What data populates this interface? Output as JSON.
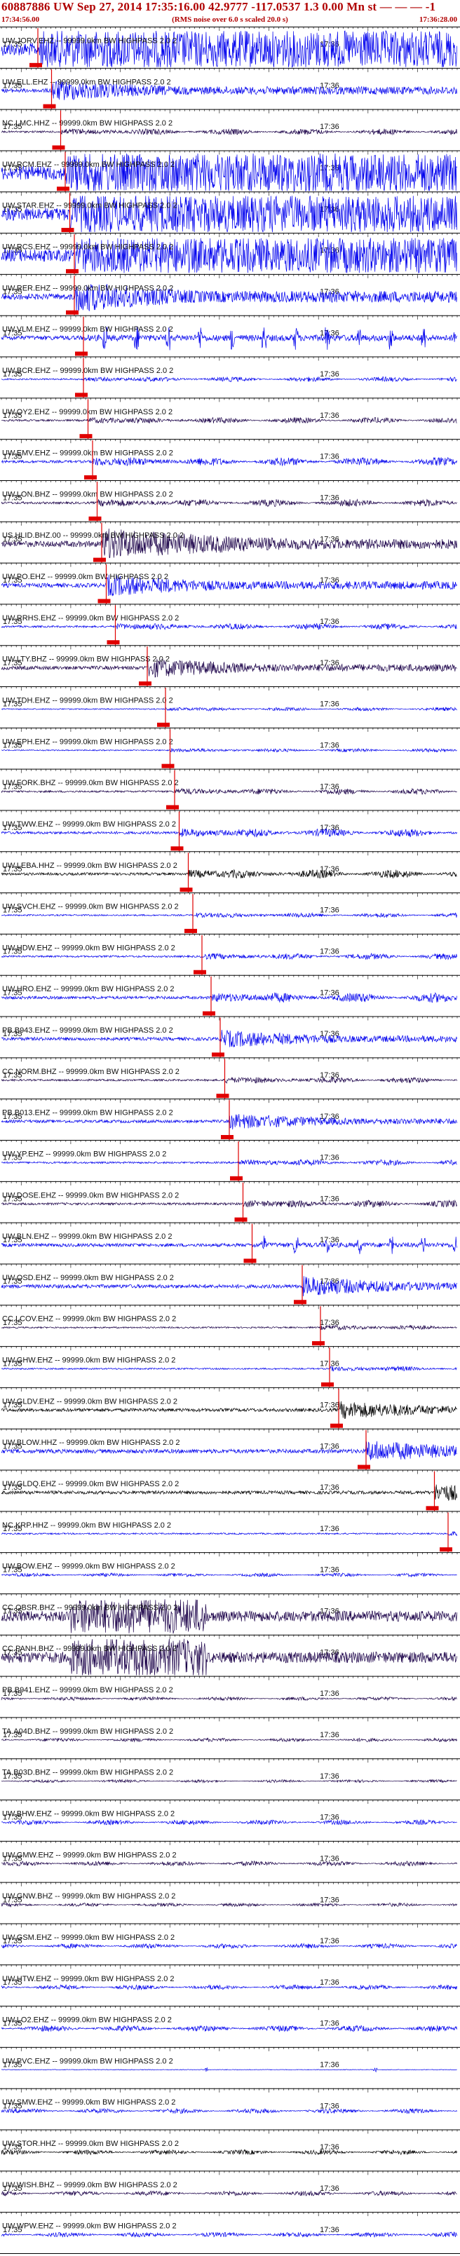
{
  "header": {
    "title": "60887886 UW Sep 27, 2014 17:35:16.00   42.9777 -117.0537  1.3 0.00 Mn st — — — -1",
    "start_time": "17:34:56.00",
    "end_time": "17:36:28.00",
    "noise_note": "(RMS noise over 6.0 s scaled 20.0 s)"
  },
  "chart_data": {
    "type": "line",
    "title": "60887886 UW Sep 27, 2014 17:35:16.00   42.9777 -117.0537  1.3 0.00 Mn st — — — -1",
    "x_range": [
      "17:34:56.00",
      "17:36:28.00"
    ],
    "time_ticks": [
      "17:35",
      "17:36"
    ],
    "grid": true,
    "colors": {
      "trace_blue": "#0000ee",
      "trace_dark": "#1a0048",
      "trace_black": "#000000",
      "pick": "#e00000",
      "grid": "#303030"
    },
    "channels": [
      {
        "label": "UW.JORV.EHZ -- 99999.0km BW  HIGHPASS  2.0  2",
        "pick": 0.08,
        "amp": 0.9,
        "color": "blue",
        "style": "sat"
      },
      {
        "label": "UW.ELL.EHZ -- 99999.0km BW  HIGHPASS  2.0  2",
        "pick": 0.11,
        "amp": 0.55,
        "color": "blue",
        "style": "event"
      },
      {
        "label": "NC.LMC.HHZ -- 99999.0km BW  HIGHPASS  2.0  2",
        "pick": 0.13,
        "amp": 0.25,
        "color": "dark",
        "style": "noise"
      },
      {
        "label": "UW.RCM.EHZ -- 99999.0km BW  HIGHPASS  2.0  2",
        "pick": 0.14,
        "amp": 0.95,
        "color": "blue",
        "style": "sat"
      },
      {
        "label": "UW.STAR.EHZ -- 99999.0km BW  HIGHPASS  2.0  2",
        "pick": 0.15,
        "amp": 0.9,
        "color": "blue",
        "style": "sat"
      },
      {
        "label": "UW.RCS.EHZ -- 99999.0km BW  HIGHPASS  2.0  2",
        "pick": 0.16,
        "amp": 0.85,
        "color": "blue",
        "style": "sat"
      },
      {
        "label": "UW.RER.EHZ -- 99999.0km BW  HIGHPASS  2.0  2",
        "pick": 0.16,
        "amp": 0.8,
        "color": "blue",
        "style": "event"
      },
      {
        "label": "UW.VLM.EHZ -- 99999.0km BW  HIGHPASS  2.0  2",
        "pick": 0.18,
        "amp": 0.6,
        "color": "blue",
        "style": "spikes"
      },
      {
        "label": "UW.BCR.EHZ -- 99999.0km BW  HIGHPASS  2.0  2",
        "pick": 0.18,
        "amp": 0.2,
        "color": "blue",
        "style": "noise"
      },
      {
        "label": "UW.OY2.EHZ -- 99999.0km BW  HIGHPASS  2.0  2",
        "pick": 0.19,
        "amp": 0.25,
        "color": "dark",
        "style": "noise"
      },
      {
        "label": "UW.EMV.EHZ -- 99999.0km BW  HIGHPASS  2.0  2",
        "pick": 0.2,
        "amp": 0.35,
        "color": "blue",
        "style": "noise"
      },
      {
        "label": "UW.LON.BHZ -- 99999.0km BW  HIGHPASS  2.0  2",
        "pick": 0.21,
        "amp": 0.3,
        "color": "dark",
        "style": "noise"
      },
      {
        "label": "US.HLID.BHZ.00 -- 99999.0km BW  HIGHPASS  2.0  2",
        "pick": 0.22,
        "amp": 0.8,
        "color": "dark",
        "style": "burst"
      },
      {
        "label": "UW.PO.EHZ -- 99999.0km BW  HIGHPASS  2.0  2",
        "pick": 0.23,
        "amp": 0.55,
        "color": "blue",
        "style": "event"
      },
      {
        "label": "UW.RRHS.EHZ -- 99999.0km BW  HIGHPASS  2.0  2",
        "pick": 0.25,
        "amp": 0.25,
        "color": "blue",
        "style": "noise"
      },
      {
        "label": "UW.LTY.BHZ -- 99999.0km BW  HIGHPASS  2.0  2",
        "pick": 0.32,
        "amp": 0.5,
        "color": "dark",
        "style": "event"
      },
      {
        "label": "UW.TDH.EHZ -- 99999.0km BW  HIGHPASS  2.0  2",
        "pick": 0.36,
        "amp": 0.15,
        "color": "blue",
        "style": "noise"
      },
      {
        "label": "UW.EPH.EHZ -- 99999.0km BW  HIGHPASS  2.0  2",
        "pick": 0.37,
        "amp": 0.15,
        "color": "blue",
        "style": "noise"
      },
      {
        "label": "UW.FORK.BHZ -- 99999.0km BW  HIGHPASS  2.0  2",
        "pick": 0.38,
        "amp": 0.25,
        "color": "dark",
        "style": "noise"
      },
      {
        "label": "UW.TWW.EHZ -- 99999.0km BW  HIGHPASS  2.0  2",
        "pick": 0.39,
        "amp": 0.35,
        "color": "blue",
        "style": "noise"
      },
      {
        "label": "UW.LEBA.HHZ -- 99999.0km BW  HIGHPASS  2.0  2",
        "pick": 0.41,
        "amp": 0.35,
        "color": "black",
        "style": "noise"
      },
      {
        "label": "UW.SVCH.EHZ -- 99999.0km BW  HIGHPASS  2.0  2",
        "pick": 0.42,
        "amp": 0.2,
        "color": "blue",
        "style": "noise"
      },
      {
        "label": "UW.HDW.EHZ -- 99999.0km BW  HIGHPASS  2.0  2",
        "pick": 0.44,
        "amp": 0.25,
        "color": "blue",
        "style": "noise"
      },
      {
        "label": "UW.HRO.EHZ -- 99999.0km BW  HIGHPASS  2.0  2",
        "pick": 0.46,
        "amp": 0.4,
        "color": "blue",
        "style": "noise"
      },
      {
        "label": "PB.B943.EHZ -- 99999.0km BW  HIGHPASS  2.0  2",
        "pick": 0.48,
        "amp": 0.45,
        "color": "blue",
        "style": "event"
      },
      {
        "label": "CC.NORM.BHZ -- 99999.0km BW  HIGHPASS  2.0  2",
        "pick": 0.49,
        "amp": 0.25,
        "color": "dark",
        "style": "noise"
      },
      {
        "label": "PB.B013.EHZ -- 99999.0km BW  HIGHPASS  2.0  2",
        "pick": 0.5,
        "amp": 0.4,
        "color": "blue",
        "style": "event"
      },
      {
        "label": "UW.YP.EHZ -- 99999.0km BW  HIGHPASS  2.0  2",
        "pick": 0.52,
        "amp": 0.25,
        "color": "blue",
        "style": "noise"
      },
      {
        "label": "UW.DOSE.EHZ -- 99999.0km BW  HIGHPASS  2.0  2",
        "pick": 0.53,
        "amp": 0.3,
        "color": "dark",
        "style": "noise"
      },
      {
        "label": "UW.BLN.EHZ -- 99999.0km BW  HIGHPASS  2.0  2",
        "pick": 0.55,
        "amp": 0.45,
        "color": "blue",
        "style": "spikes"
      },
      {
        "label": "UW.OSD.EHZ -- 99999.0km BW  HIGHPASS  2.0  2",
        "pick": 0.66,
        "amp": 0.5,
        "color": "blue",
        "style": "event"
      },
      {
        "label": "CC.LCOV.EHZ -- 99999.0km BW  HIGHPASS  2.0  2",
        "pick": 0.7,
        "amp": 0.2,
        "color": "dark",
        "style": "noise"
      },
      {
        "label": "UW.GHW.EHZ -- 99999.0km BW  HIGHPASS  2.0  2",
        "pick": 0.72,
        "amp": 0.2,
        "color": "blue",
        "style": "noise"
      },
      {
        "label": "UW.GLDV.EHZ -- 99999.0km BW  HIGHPASS  2.0  2",
        "pick": 0.74,
        "amp": 0.45,
        "color": "black",
        "style": "event"
      },
      {
        "label": "UW.BLOW.HHZ -- 99999.0km BW  HIGHPASS  2.0  2",
        "pick": 0.8,
        "amp": 0.55,
        "color": "blue",
        "style": "event"
      },
      {
        "label": "UW.GLDQ.EHZ -- 99999.0km BW  HIGHPASS  2.0  2",
        "pick": 0.95,
        "amp": 0.45,
        "color": "black",
        "style": "event"
      },
      {
        "label": "NC.KRP.HHZ -- 99999.0km BW  HIGHPASS  2.0  2",
        "pick": 0.98,
        "amp": 0.2,
        "color": "blue",
        "style": "noise"
      },
      {
        "label": "UW.BOW.EHZ -- 99999.0km BW  HIGHPASS  2.0  2",
        "pick": null,
        "amp": 0.15,
        "color": "blue",
        "style": "noise"
      },
      {
        "label": "CC.OBSR.BHZ -- 99999.0km BW  HIGHPASS  2.0  2",
        "pick": null,
        "amp": 0.85,
        "color": "dark",
        "style": "burst"
      },
      {
        "label": "CC.PANH.BHZ -- 99999.0km BW  HIGHPASS  2.0  2",
        "pick": null,
        "amp": 0.9,
        "color": "dark",
        "style": "burst"
      },
      {
        "label": "PB.B941.EHZ -- 99999.0km BW  HIGHPASS  2.0  2",
        "pick": null,
        "amp": 0.15,
        "color": "dark",
        "style": "noise"
      },
      {
        "label": "TA.A04D.BHZ -- 99999.0km BW  HIGHPASS  2.0  2",
        "pick": null,
        "amp": 0.15,
        "color": "dark",
        "style": "noise"
      },
      {
        "label": "TA.B03D.BHZ -- 99999.0km BW  HIGHPASS  2.0  2",
        "pick": null,
        "amp": 0.12,
        "color": "dark",
        "style": "noise"
      },
      {
        "label": "UW.BHW.EHZ -- 99999.0km BW  HIGHPASS  2.0  2",
        "pick": null,
        "amp": 0.2,
        "color": "blue",
        "style": "noise"
      },
      {
        "label": "UW.GMW.EHZ -- 99999.0km BW  HIGHPASS  2.0  2",
        "pick": null,
        "amp": 0.2,
        "color": "dark",
        "style": "noise"
      },
      {
        "label": "UW.GNW.BHZ -- 99999.0km BW  HIGHPASS  2.0  2",
        "pick": null,
        "amp": 0.15,
        "color": "dark",
        "style": "noise"
      },
      {
        "label": "UW.GSM.EHZ -- 99999.0km BW  HIGHPASS  2.0  2",
        "pick": null,
        "amp": 0.2,
        "color": "blue",
        "style": "noise"
      },
      {
        "label": "UW.HTW.EHZ -- 99999.0km BW  HIGHPASS  2.0  2",
        "pick": null,
        "amp": 0.2,
        "color": "blue",
        "style": "noise"
      },
      {
        "label": "UW.LO2.EHZ -- 99999.0km BW  HIGHPASS  2.0  2",
        "pick": null,
        "amp": 0.25,
        "color": "blue",
        "style": "noise"
      },
      {
        "label": "UW.PVC.EHZ -- 99999.0km BW  HIGHPASS  2.0  2",
        "pick": null,
        "amp": 0.1,
        "color": "blue",
        "style": "spikes"
      },
      {
        "label": "UW.SMW.EHZ -- 99999.0km BW  HIGHPASS  2.0  2",
        "pick": null,
        "amp": 0.2,
        "color": "blue",
        "style": "noise"
      },
      {
        "label": "UW.STOR.HHZ -- 99999.0km BW  HIGHPASS  2.0  2",
        "pick": null,
        "amp": 0.2,
        "color": "black",
        "style": "noise"
      },
      {
        "label": "UW.WISH.BHZ -- 99999.0km BW  HIGHPASS  2.0  2",
        "pick": null,
        "amp": 0.2,
        "color": "dark",
        "style": "noise"
      },
      {
        "label": "UW.WPW.EHZ -- 99999.0km BW  HIGHPASS  2.0  2",
        "pick": null,
        "amp": 0.2,
        "color": "blue",
        "style": "noise"
      }
    ]
  }
}
